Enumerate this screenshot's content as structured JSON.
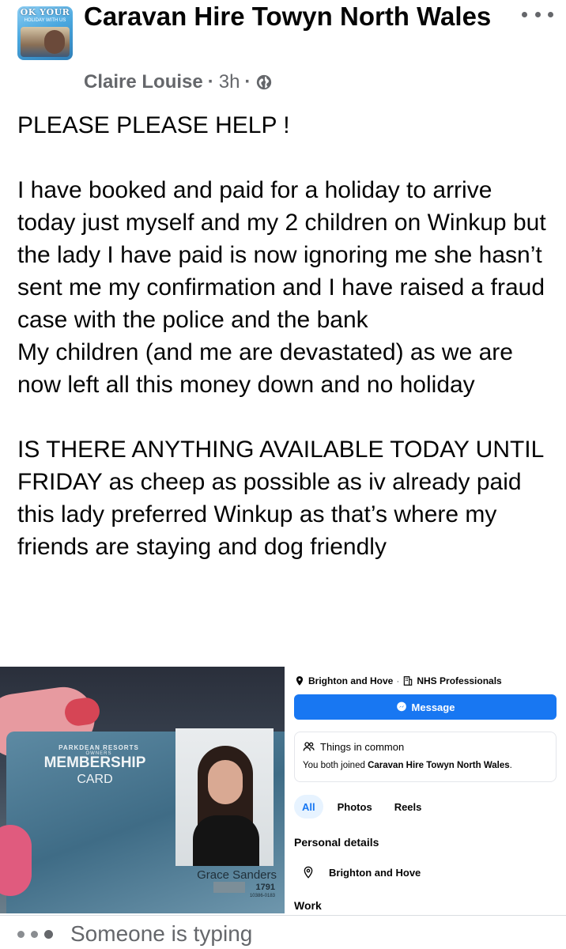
{
  "header": {
    "group_name": "Caravan Hire Towyn North Wales",
    "avatar_logo_text": "OK YOUR",
    "avatar_logo_sub": "HOLIDAY WITH US",
    "author": "Claire Louise",
    "time": "3h",
    "separator": "·"
  },
  "post": {
    "paragraphs": [
      "PLEASE PLEASE HELP !",
      "I have booked and paid for a holiday to arrive today just myself and my 2 children on Winkup but the lady I have paid is now ignoring me she hasn’t sent me my confirmation and I have raised a fraud case with the police and the bank",
      "My children (and me are devastated) as we are now left all this money down and no holiday",
      "IS THERE ANYTHING AVAILABLE TODAY UNTIL FRIDAY as cheep as possible as iv already paid this lady preferred Winkup as that’s where my friends are staying and dog friendly"
    ]
  },
  "card": {
    "logo": "PARKDEAN RESORTS",
    "logo_sub": "OWNERS",
    "title": "MEMBERSHIP",
    "subtitle": "CARD",
    "name": "Grace Sanders",
    "number": "1791",
    "number_small": "10386-0183"
  },
  "profile": {
    "location": "Brighton and Hove",
    "workplace": "NHS Professionals",
    "dot": "·",
    "message_button": "Message",
    "things_in_common": "Things in common",
    "common_prefix": "You both joined ",
    "common_group": "Caravan Hire Towyn North Wales",
    "common_suffix": ".",
    "tabs": [
      "All",
      "Photos",
      "Reels"
    ],
    "personal_details": "Personal details",
    "detail_location": "Brighton and Hove",
    "work_heading": "Work"
  },
  "footer": {
    "typing_text": "Someone is typing"
  }
}
